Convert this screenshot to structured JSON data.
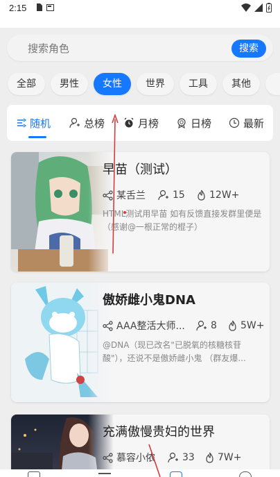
{
  "status": {
    "time": "2:15"
  },
  "search": {
    "placeholder": "搜索角色",
    "button": "搜索"
  },
  "filters": [
    "全部",
    "男性",
    "女性",
    "世界",
    "工具",
    "其他"
  ],
  "active_filter": "女性",
  "tabs": [
    "随机",
    "总榜",
    "月榜",
    "日榜",
    "最新"
  ],
  "active_tab": "随机",
  "cards": [
    {
      "title": "早苗（测试）",
      "author": "某舌兰",
      "followers": "15",
      "heat": "12W+",
      "desc": "HTML测试用早苗 如有反馈直接发群里便是（感谢@一根正常的棍子）"
    },
    {
      "title": "傲娇雌小鬼DNA",
      "author": "AAA整活大师...",
      "followers": "8",
      "heat": "5W+",
      "desc": "@DNA（现已改名\"已脱氧的核糖核苷酸\"），还说不是傲娇雌小鬼 （群友爆..."
    },
    {
      "title": "充满傲慢贵妇的世界",
      "author": "慕容小侬",
      "followers": "33",
      "heat": "7W+"
    }
  ],
  "colors": {
    "accent": "#1677ff",
    "annotation": "#d63b3b"
  }
}
